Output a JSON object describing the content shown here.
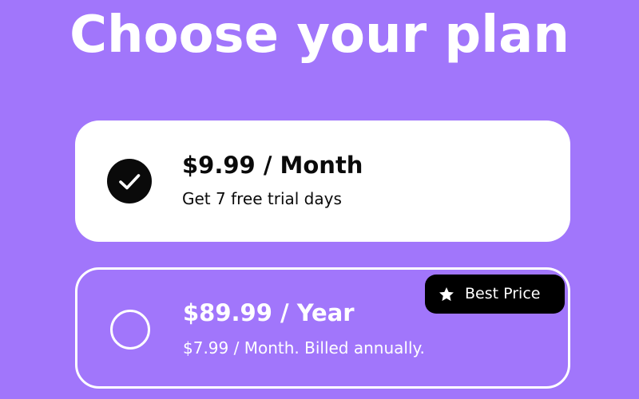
{
  "page": {
    "title": "Choose your plan"
  },
  "plans": [
    {
      "price_label": "$9.99 / Month",
      "description": "Get 7 free trial days",
      "selected": true
    },
    {
      "price_label": "$89.99 / Year",
      "description": "$7.99 / Month. Billed annually.",
      "selected": false,
      "badge": {
        "label": "Best Price",
        "icon": "star-icon"
      }
    }
  ],
  "colors": {
    "background": "#a176fb",
    "card_selected": "#ffffff",
    "text_dark": "#0a0a0a",
    "badge_bg": "#000000"
  }
}
